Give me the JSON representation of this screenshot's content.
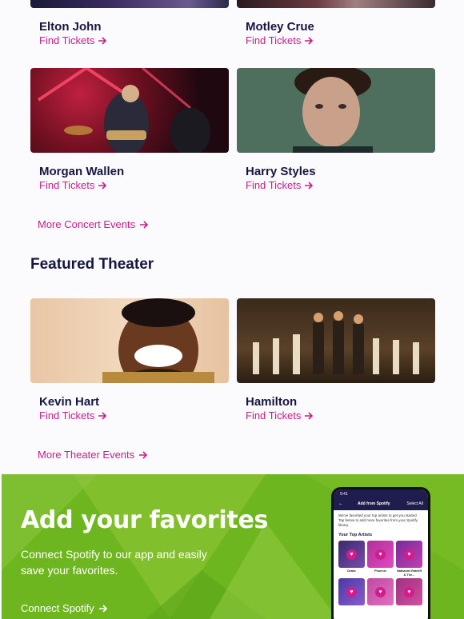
{
  "concerts": {
    "top_row": [
      {
        "name": "Elton John",
        "link": "Find Tickets"
      },
      {
        "name": "Motley Crue",
        "link": "Find Tickets"
      }
    ],
    "second_row": [
      {
        "name": "Morgan Wallen",
        "link": "Find Tickets"
      },
      {
        "name": "Harry Styles",
        "link": "Find Tickets"
      }
    ],
    "more_link": "More Concert Events"
  },
  "theater": {
    "title": "Featured Theater",
    "items": [
      {
        "name": "Kevin Hart",
        "link": "Find Tickets"
      },
      {
        "name": "Hamilton",
        "link": "Find Tickets"
      }
    ],
    "more_link": "More Theater Events"
  },
  "promo": {
    "title": "Add your favorites",
    "text": "Connect Spotify to our app and easily save your favorites.",
    "link": "Connect Spotify",
    "phone": {
      "time": "9:41",
      "back": "←",
      "header": "Add from Spotify",
      "select_all": "Select All",
      "description": "We've favorited your top artists to get you started. Tap below to add more favorites from your Spotify library.",
      "section": "Your Top Artists",
      "artists": [
        "Drake",
        "Phoenix",
        "Nathaniel Rateliff & The..."
      ]
    }
  },
  "colors": {
    "accent": "#c41e8c",
    "heading": "#16163f",
    "promo_bg": "#6eb61f"
  }
}
